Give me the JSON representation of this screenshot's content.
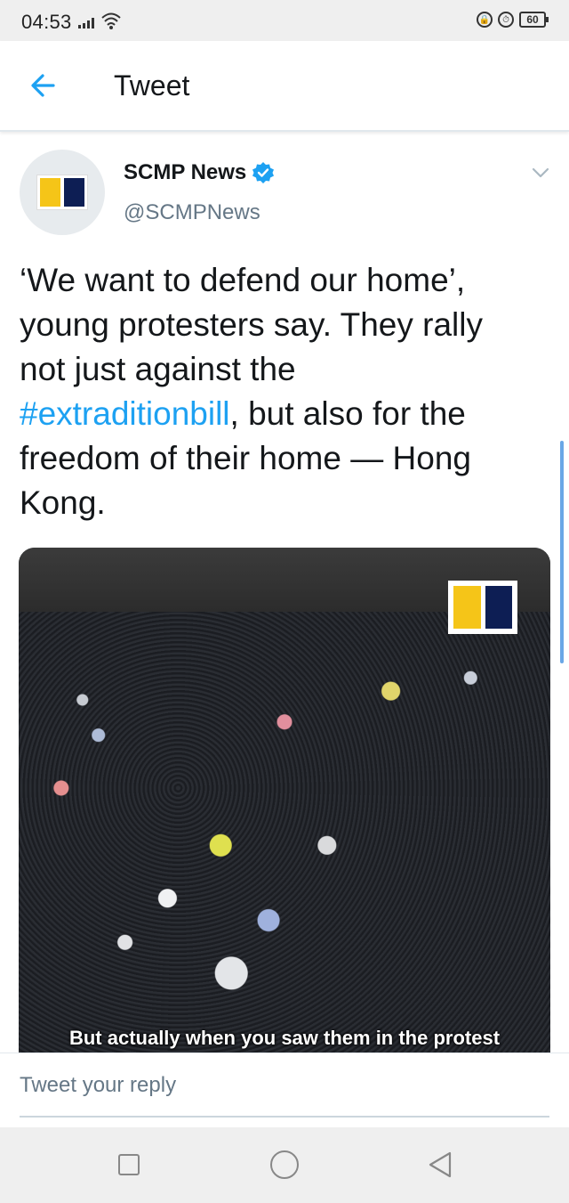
{
  "status_bar": {
    "time": "04:53",
    "battery": "60"
  },
  "header": {
    "title": "Tweet"
  },
  "tweet": {
    "author_name": "SCMP News",
    "author_handle": "@SCMPNews",
    "text_before": "‘We want to defend our home’, young protesters say. They rally not just against the ",
    "hashtag": "#extraditionbill",
    "text_after": ", but also for the freedom of their home — Hong Kong.",
    "media_subtitle": "But actually when you saw them in the protest"
  },
  "reply": {
    "placeholder": "Tweet your reply"
  },
  "colors": {
    "accent": "#1da1f2",
    "logo_yellow": "#f5c518",
    "logo_navy": "#0d1e54"
  },
  "icons": [
    "back-arrow-icon",
    "verified-badge-icon",
    "chevron-down-icon",
    "recents-icon",
    "home-icon",
    "nav-back-icon"
  ]
}
